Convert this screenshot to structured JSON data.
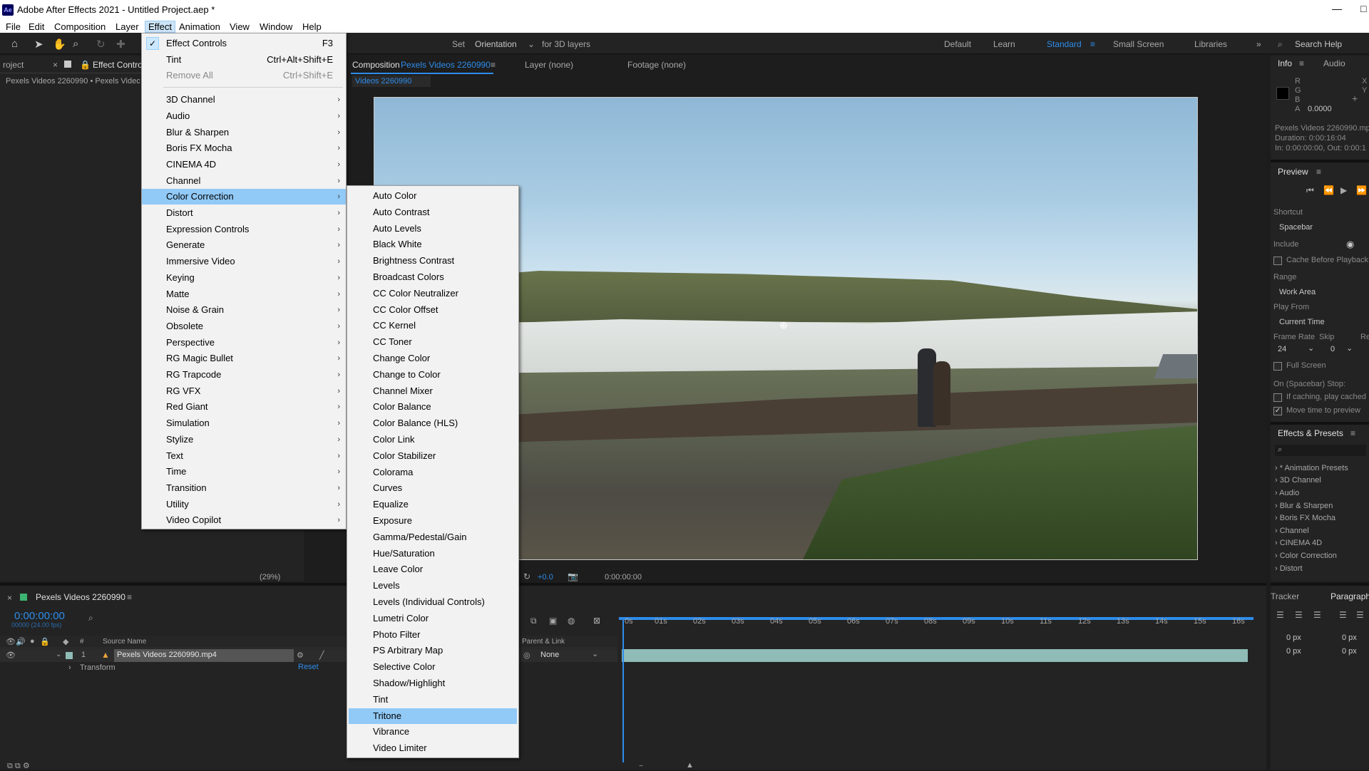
{
  "window": {
    "title": "Adobe After Effects 2021 - Untitled Project.aep *",
    "logo": "Ae",
    "minimize": "—",
    "maximize": "□"
  },
  "menubar": [
    "File",
    "Edit",
    "Composition",
    "Layer",
    "Effect",
    "Animation",
    "View",
    "Window",
    "Help"
  ],
  "toolbar": {
    "set_label": "Set",
    "orientation_label": "Orientation",
    "for3d_label": "for 3D layers",
    "workspaces": [
      "Default",
      "Learn",
      "Standard",
      "Small Screen",
      "Libraries"
    ],
    "active_workspace": "Standard",
    "search_help": "Search Help"
  },
  "left_panel": {
    "project_tab": "roject",
    "effect_controls_tab": "Effect Control",
    "breadcrumb": "Pexels Videos 2260990 • Pexels Videc",
    "zoom": "(29%)"
  },
  "viewer": {
    "comp_tab_prefix": "Composition",
    "comp_tab_name": "Pexels Videos 2260990",
    "layer_tab": "Layer (none)",
    "footage_tab": "Footage (none)",
    "subtab": "Videos 2260990",
    "exposure": "+0.0",
    "timecode": "0:00:00:00"
  },
  "effect_menu": {
    "items": [
      {
        "label": "Effect Controls",
        "shortcut": "F3",
        "checked": true
      },
      {
        "label": "Tint",
        "shortcut": "Ctrl+Alt+Shift+E"
      },
      {
        "label": "Remove All",
        "shortcut": "Ctrl+Shift+E",
        "disabled": true
      },
      {
        "label": "3D Channel",
        "submenu": true
      },
      {
        "label": "Audio",
        "submenu": true
      },
      {
        "label": "Blur & Sharpen",
        "submenu": true
      },
      {
        "label": "Boris FX Mocha",
        "submenu": true
      },
      {
        "label": "CINEMA 4D",
        "submenu": true
      },
      {
        "label": "Channel",
        "submenu": true
      },
      {
        "label": "Color Correction",
        "submenu": true,
        "highlighted": true
      },
      {
        "label": "Distort",
        "submenu": true
      },
      {
        "label": "Expression Controls",
        "submenu": true
      },
      {
        "label": "Generate",
        "submenu": true
      },
      {
        "label": "Immersive Video",
        "submenu": true
      },
      {
        "label": "Keying",
        "submenu": true
      },
      {
        "label": "Matte",
        "submenu": true
      },
      {
        "label": "Noise & Grain",
        "submenu": true
      },
      {
        "label": "Obsolete",
        "submenu": true
      },
      {
        "label": "Perspective",
        "submenu": true
      },
      {
        "label": "RG Magic Bullet",
        "submenu": true
      },
      {
        "label": "RG Trapcode",
        "submenu": true
      },
      {
        "label": "RG VFX",
        "submenu": true
      },
      {
        "label": "Red Giant",
        "submenu": true
      },
      {
        "label": "Simulation",
        "submenu": true
      },
      {
        "label": "Stylize",
        "submenu": true
      },
      {
        "label": "Text",
        "submenu": true
      },
      {
        "label": "Time",
        "submenu": true
      },
      {
        "label": "Transition",
        "submenu": true
      },
      {
        "label": "Utility",
        "submenu": true
      },
      {
        "label": "Video Copilot",
        "submenu": true
      }
    ]
  },
  "color_correction_menu": {
    "items": [
      "Auto Color",
      "Auto Contrast",
      "Auto Levels",
      "Black  White",
      "Brightness  Contrast",
      "Broadcast Colors",
      "CC Color Neutralizer",
      "CC Color Offset",
      "CC Kernel",
      "CC Toner",
      "Change Color",
      "Change to Color",
      "Channel Mixer",
      "Color Balance",
      "Color Balance (HLS)",
      "Color Link",
      "Color Stabilizer",
      "Colorama",
      "Curves",
      "Equalize",
      "Exposure",
      "Gamma/Pedestal/Gain",
      "Hue/Saturation",
      "Leave Color",
      "Levels",
      "Levels (Individual Controls)",
      "Lumetri Color",
      "Photo Filter",
      "PS Arbitrary Map",
      "Selective Color",
      "Shadow/Highlight",
      "Tint",
      "Tritone",
      "Vibrance",
      "Video Limiter"
    ],
    "highlighted": "Tritone"
  },
  "info_panel": {
    "tab_info": "Info",
    "tab_audio": "Audio",
    "r": "R",
    "g": "G",
    "b": "B",
    "a": "A",
    "a_value": "0.0000",
    "x": "X",
    "y": "Y",
    "file_name": "Pexels Videos 2260990.mp",
    "duration": "Duration: 0:00:16:04",
    "in_out": "In: 0:00:00:00, Out: 0:00:1"
  },
  "preview_panel": {
    "title": "Preview",
    "shortcut_label": "Shortcut",
    "shortcut_value": "Spacebar",
    "include_label": "Include",
    "cache_label": "Cache Before Playback",
    "range_label": "Range",
    "range_value": "Work Area",
    "play_from_label": "Play From",
    "play_from_value": "Current Time",
    "frame_rate_label": "Frame Rate",
    "skip_label": "Skip",
    "res_label": "Re",
    "frame_rate_value": "24",
    "skip_value": "0",
    "full_screen_label": "Full Screen",
    "on_stop_label": "On (Spacebar) Stop:",
    "if_caching_label": "If caching, play cached",
    "move_time_label": "Move time to preview"
  },
  "effects_presets": {
    "title": "Effects & Presets",
    "items": [
      "* Animation Presets",
      "3D Channel",
      "Audio",
      "Blur & Sharpen",
      "Boris FX Mocha",
      "Channel",
      "CINEMA 4D",
      "Color Correction",
      "Distort"
    ]
  },
  "timeline": {
    "comp_name": "Pexels Videos 2260990",
    "timecode": "0:00:00:00",
    "frame_info": "00000 (24.00 fps)",
    "source_name_header": "Source Name",
    "parent_header": "Parent & Link",
    "layer_number": "1",
    "layer_name": "Pexels Videos 2260990.mp4",
    "parent_value": "None",
    "transform_label": "Transform",
    "reset_label": "Reset",
    "ticks": [
      "0s",
      "01s",
      "02s",
      "03s",
      "04s",
      "05s",
      "06s",
      "07s",
      "08s",
      "09s",
      "10s",
      "11s",
      "12s",
      "13s",
      "14s",
      "15s",
      "16s"
    ]
  },
  "tracker_panel": {
    "tab_tracker": "Tracker",
    "tab_paragraph": "Paragraph",
    "px_values": [
      "0 px",
      "0 px",
      "0 px",
      "0 px"
    ]
  },
  "colors": {
    "accent": "#2d8ceb",
    "menu_highlight": "#91c9f7",
    "layer_bar": "#8fbcb6"
  }
}
